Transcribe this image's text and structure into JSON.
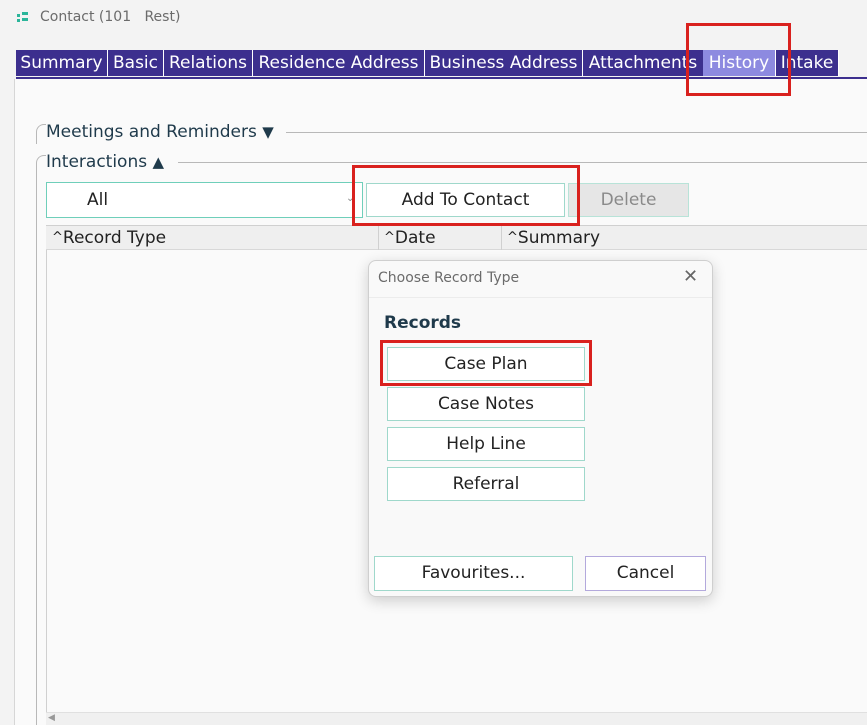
{
  "window": {
    "title": "Contact (101   Rest)",
    "icon": "app-icon"
  },
  "tabs": [
    {
      "label": "Summary",
      "active": false
    },
    {
      "label": "Basic",
      "active": false
    },
    {
      "label": "Relations",
      "active": false
    },
    {
      "label": "Residence Address",
      "active": false
    },
    {
      "label": "Business Address",
      "active": false
    },
    {
      "label": "Attachments",
      "active": false
    },
    {
      "label": "History",
      "active": true
    },
    {
      "label": "Intake",
      "active": false
    }
  ],
  "sections": {
    "meetings": {
      "label": "Meetings and Reminders",
      "expanded": false
    },
    "interactions": {
      "label": "Interactions",
      "expanded": true
    }
  },
  "interactions": {
    "filter_value": "All",
    "add_button": "Add To Contact",
    "delete_button": "Delete",
    "columns": [
      "Record Type",
      "Date",
      "Summary"
    ]
  },
  "dialog": {
    "title": "Choose Record Type",
    "section": "Records",
    "records": [
      "Case Plan",
      "Case Notes",
      "Help Line",
      "Referral"
    ],
    "favourites_button": "Favourites...",
    "cancel_button": "Cancel"
  },
  "colors": {
    "tab_bg": "#3c2f8e",
    "tab_active_bg": "#8d8ae0",
    "highlight_red": "#d9211e",
    "button_border": "#9fd8cb"
  }
}
